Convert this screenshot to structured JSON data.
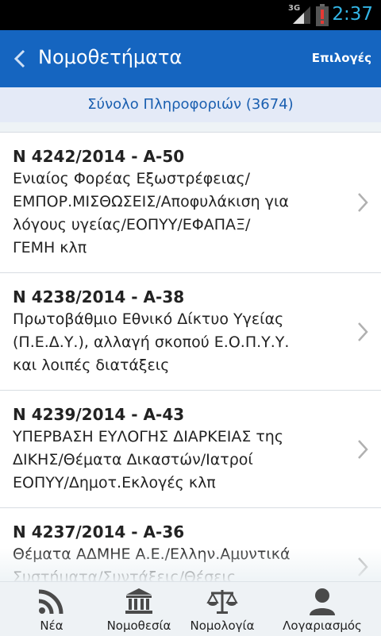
{
  "status_bar": {
    "network": "3G",
    "time": "2:37"
  },
  "action_bar": {
    "title": "Νομοθετήματα",
    "options_label": "Επιλογές"
  },
  "summary": {
    "text": "Σύνολο Πληροφοριών (3674)"
  },
  "laws": [
    {
      "number": "Ν 4242/2014 - Α-50",
      "desc_lines": [
        "Ενιαίος Φορέας Εξωστρέφειας/",
        "ΕΜΠΟΡ.ΜΙΣΘΩΣΕΙΣ/Αποφυλάκιση για",
        "λόγους υγείας/ΕΟΠΥΥ/ΕΦΑΠΑΞ/",
        "ΓΕΜΗ κλπ"
      ]
    },
    {
      "number": "Ν 4238/2014 - Α-38",
      "desc_lines": [
        "Πρωτοβάθμιο Εθνικό Δίκτυο Υγείας",
        "(Π.Ε.Δ.Υ.), αλλαγή σκοπού Ε.Ο.Π.Υ.Υ.",
        "και λοιπές διατάξεις"
      ]
    },
    {
      "number": "Ν 4239/2014 - Α-43",
      "desc_lines": [
        "ΥΠΕΡΒΑΣΗ ΕΥΛΟΓΗΣ ΔΙΑΡΚΕΙΑΣ της",
        "ΔΙΚΗΣ/Θέματα Δικαστών/Ιατροί",
        "ΕΟΠΥΥ/Δημοτ.Εκλογές κλπ"
      ]
    },
    {
      "number": "Ν 4237/2014 - Α-36",
      "desc_lines": [
        "Θέματα ΑΔΜΗΕ Α.Ε./Ελλην.Αμυντικά",
        "Συστήματα/Συντάξεις/Θέσεις"
      ]
    }
  ],
  "bottom_nav": [
    {
      "label": "Νέα",
      "icon": "rss-icon"
    },
    {
      "label": "Νομοθεσία",
      "icon": "courthouse-icon"
    },
    {
      "label": "Νομολογία",
      "icon": "scales-icon"
    },
    {
      "label": "Λογαριασμός",
      "icon": "user-icon"
    }
  ],
  "colors": {
    "primary": "#1565c0",
    "summary_bg": "#e4eaf7",
    "summary_text": "#1a5fb0",
    "status_time": "#33b5e5",
    "battery_alert": "#e53935"
  }
}
